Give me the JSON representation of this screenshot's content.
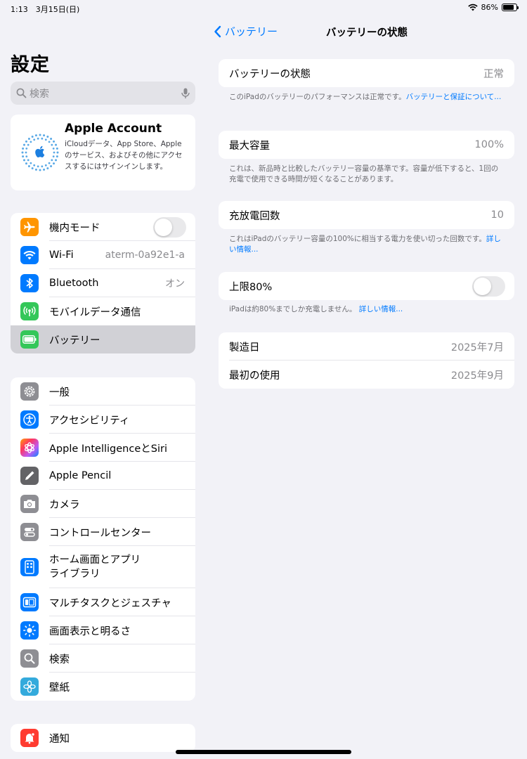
{
  "status": {
    "time": "1:13",
    "date": "3月15日(日)",
    "battery_percent": "86%",
    "battery_level": 86
  },
  "sidebar": {
    "title": "設定",
    "search_placeholder": "検索",
    "account": {
      "title": "Apple Account",
      "description": "iCloudデータ、App Store、Appleのサービス、およびその他にアクセスするにはサインインします。"
    },
    "group1": [
      {
        "label": "機内モード",
        "icon": "airplane-icon",
        "color": "#ff9500",
        "toggle": false
      },
      {
        "label": "Wi-Fi",
        "icon": "wifi-icon",
        "color": "#007aff",
        "value": "aterm-0a92e1-a"
      },
      {
        "label": "Bluetooth",
        "icon": "bluetooth-icon",
        "color": "#007aff",
        "value": "オン"
      },
      {
        "label": "モバイルデータ通信",
        "icon": "antenna-icon",
        "color": "#34c759"
      },
      {
        "label": "バッテリー",
        "icon": "battery-icon",
        "color": "#34c759",
        "selected": true
      }
    ],
    "group2": [
      {
        "label": "一般",
        "icon": "gear-icon",
        "color": "#8e8e93"
      },
      {
        "label": "アクセシビリティ",
        "icon": "accessibility-icon",
        "color": "#007aff"
      },
      {
        "label": "Apple IntelligenceとSiri",
        "icon": "apple-intelligence-icon",
        "color": "#ff6482"
      },
      {
        "label": "Apple Pencil",
        "icon": "pencil-icon",
        "color": "#636366"
      },
      {
        "label": "カメラ",
        "icon": "camera-icon",
        "color": "#8e8e93"
      },
      {
        "label": "コントロールセンター",
        "icon": "control-center-icon",
        "color": "#8e8e93"
      },
      {
        "label": "ホーム画面とアプリライブラリ",
        "icon": "home-screen-icon",
        "color": "#007aff"
      },
      {
        "label": "マルチタスクとジェスチャ",
        "icon": "multitasking-icon",
        "color": "#007aff"
      },
      {
        "label": "画面表示と明るさ",
        "icon": "brightness-icon",
        "color": "#007aff"
      },
      {
        "label": "検索",
        "icon": "search-icon",
        "color": "#8e8e93"
      },
      {
        "label": "壁紙",
        "icon": "wallpaper-icon",
        "color": "#34aadc"
      }
    ],
    "group3": [
      {
        "label": "通知",
        "icon": "notification-icon",
        "color": "#ff3b30"
      }
    ]
  },
  "detail": {
    "back_label": "バッテリー",
    "title": "バッテリーの状態",
    "health": {
      "label": "バッテリーの状態",
      "value": "正常"
    },
    "health_note": {
      "text": "このiPadのバッテリーのパフォーマンスは正常です。",
      "link": "バッテリーと保証について..."
    },
    "max_capacity": {
      "label": "最大容量",
      "value": "100%"
    },
    "max_capacity_note": "これは、新品時と比較したバッテリー容量の基準です。容量が低下すると、1回の充電で使用できる時間が短くなることがあります。",
    "cycle_count": {
      "label": "充放電回数",
      "value": "10"
    },
    "cycle_note": {
      "text": "これはiPadのバッテリー容量の100%に相当する電力を使い切った回数です。",
      "link": "詳しい情報..."
    },
    "limit": {
      "label": "上限80%",
      "toggle": false
    },
    "limit_note": {
      "text": "iPadは約80%までしか充電しません。",
      "link": "詳しい情報..."
    },
    "manufacture": {
      "label": "製造日",
      "value": "2025年7月"
    },
    "first_use": {
      "label": "最初の使用",
      "value": "2025年9月"
    }
  }
}
